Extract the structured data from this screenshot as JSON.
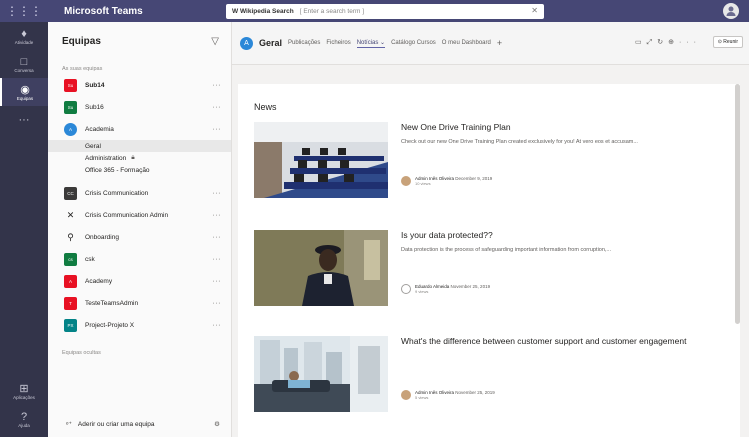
{
  "app": {
    "title": "Microsoft Teams"
  },
  "search": {
    "prefix": "W Wikipedia Search",
    "placeholder": "[ Enter a search term ]"
  },
  "rail": [
    {
      "label": "Atividade",
      "icon": "bell-icon",
      "glyph": "🔔"
    },
    {
      "label": "Conversa",
      "icon": "chat-icon",
      "glyph": "💬"
    },
    {
      "label": "Equipas",
      "icon": "teams-icon",
      "glyph": "👥"
    },
    {
      "label": "",
      "icon": "more-apps-icon",
      "glyph": "···"
    }
  ],
  "rail_bottom": [
    {
      "label": "Aplicações",
      "icon": "apps-icon",
      "glyph": "⊞"
    },
    {
      "label": "Ajuda",
      "icon": "help-icon",
      "glyph": "?"
    }
  ],
  "panel": {
    "title": "Equipas",
    "section": "As suas equipas",
    "hidden": "Equipas ocultas",
    "footer": "Aderir ou criar uma equipa",
    "teams": [
      {
        "name": "Sub14",
        "abbr": "Su",
        "color": "#e81123",
        "bold": true
      },
      {
        "name": "Sub16",
        "abbr": "Su",
        "color": "#107c41",
        "bold": false
      },
      {
        "name": "Academia",
        "abbr": "A",
        "color": "#2b88d8",
        "bold": false,
        "round": true
      }
    ],
    "channels": [
      "Geral",
      "Administration",
      "Office 365 - Formação"
    ],
    "teams2": [
      {
        "name": "Crisis Communication",
        "abbr": "CC",
        "color": "#3b3a39"
      },
      {
        "name": "Crisis Communication Admin",
        "abbr": "✕",
        "color": "#ffffff",
        "dark": true
      },
      {
        "name": "Onboarding",
        "abbr": "⚲",
        "color": "#ffffff",
        "dark": true
      },
      {
        "name": "csk",
        "abbr": "cs",
        "color": "#107c41"
      },
      {
        "name": "Academy",
        "abbr": "A",
        "color": "#e81123"
      },
      {
        "name": "TesteTeamsAdmin",
        "abbr": "T",
        "color": "#e81123"
      },
      {
        "name": "Project-Projeto X",
        "abbr": "PX",
        "color": "#038387"
      }
    ]
  },
  "channel_header": {
    "name": "Geral",
    "tabs": [
      "Publicações",
      "Ficheiros",
      "Notícias ⌄",
      "Catálogo Cursos",
      "O meu Dashboard",
      "+"
    ],
    "active_tab": 2,
    "meet": "⊙ Reunir"
  },
  "news": {
    "title": "News",
    "articles": [
      {
        "title": "New One Drive Training Plan",
        "desc": "Check out our new One Drive Training Plan created exclusively for you! At vero eos et accusam...",
        "author": "Admin Inês Oliveira",
        "date": "December 9, 2019",
        "views": "10 views"
      },
      {
        "title": "Is your data protected??",
        "desc": "Data protection is the process of safeguarding important information from corruption,...",
        "author": "Eduardo Almeida",
        "date": "November 25, 2019",
        "views": "9 views"
      },
      {
        "title": "What's the difference between customer support and customer engagement",
        "desc": "",
        "author": "Admin Inês Oliveira",
        "date": "November 25, 2019",
        "views": "5 views"
      }
    ]
  }
}
